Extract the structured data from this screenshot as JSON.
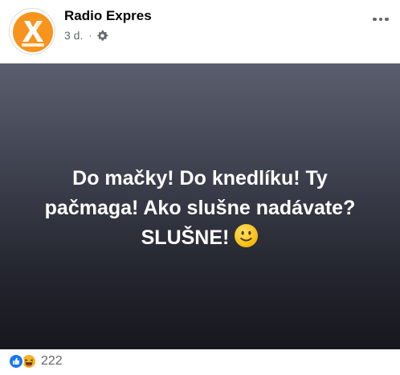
{
  "post": {
    "page_name": "Radio Expres",
    "time": "3 d.",
    "separator": "·",
    "privacy_icon": "gear-icon",
    "avatar_logo_text": "RADIO EXPRES",
    "text_line_1": "Do mačky! Do knedlíku! Ty",
    "text_line_2": "pačmaga!  Ako slušne nadávate?",
    "text_line_3": "SLUŠNE!",
    "emoji": "slightly-smiling-face",
    "background_colors": [
      "#5a5e6e",
      "#17181e"
    ],
    "text_color": "#ffffff"
  },
  "reactions": {
    "icons": [
      "like-icon",
      "haha-icon"
    ],
    "count": "222",
    "like_color": "#1877f2",
    "haha_color": "#f7b125"
  },
  "brand": {
    "orange": "#f7941d"
  }
}
